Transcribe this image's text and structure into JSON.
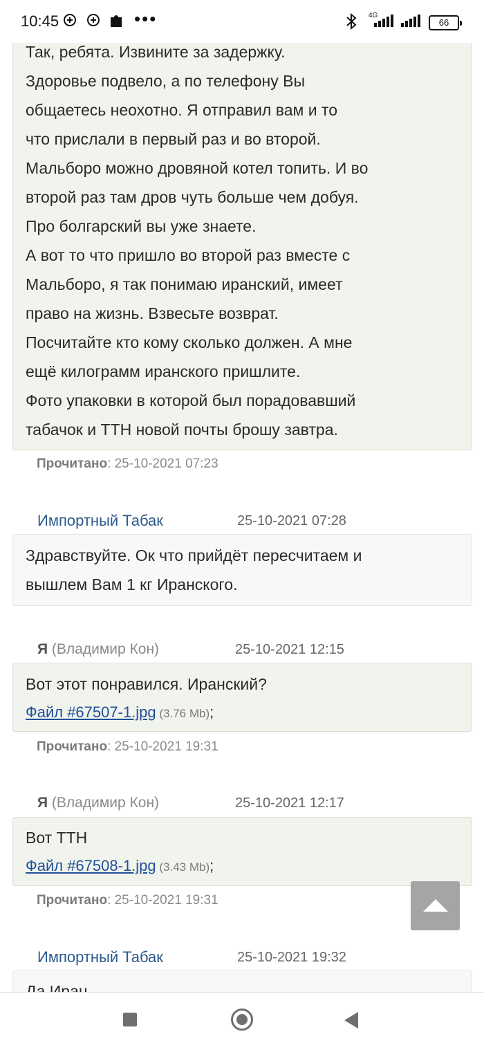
{
  "status_bar": {
    "time": "10:45",
    "network": "4G",
    "battery": "66",
    "icons": [
      "location-plus-icon",
      "location-plus-icon",
      "puzzle-icon",
      "more-dots-icon",
      "bluetooth-icon",
      "signal-icon",
      "signal-icon",
      "battery-icon"
    ]
  },
  "messages": [
    {
      "lines": [
        "Так, ребята. Извините за задержку.",
        "Здоровье подвело, а по телефону Вы",
        "общаетесь неохотно. Я отправил вам и то",
        "что прислали в первый раз и во второй.",
        "Мальборо можно дровяной котел топить. И во",
        "второй раз там дров чуть больше чем добуя.",
        "Про болгарский вы уже знаете.",
        "А вот то что пришло во второй раз вместе с",
        "Мальборо, я так понимаю иранский, имеет",
        "право на жизнь. Взвесьте возврат.",
        "Посчитайте кто кому сколько должен. А мне",
        "ещё килограмм иранского пришлите.",
        "Фото упаковки в которой был порадовавший",
        "табачок и ТТН новой почты брошу завтра."
      ],
      "read_label": "Прочитано",
      "read_time": ": 25-10-2021 07:23"
    },
    {
      "sender": "Импортный Табак",
      "time": "25-10-2021 07:28",
      "lines": [
        "Здравствуйте. Ок что прийдёт пересчитаем и",
        "вышлем Вам 1 кг Иранского."
      ]
    },
    {
      "sender_me": "Я",
      "sender_name": " (Владимир Кон)",
      "time": "25-10-2021 12:15",
      "text": "Вот этот понравился. Иранский?",
      "file_link": "Файл #67507-1.jpg",
      "file_size": " (3.76 Mb)",
      "file_sep": ";",
      "read_label": "Прочитано",
      "read_time": ": 25-10-2021 19:31"
    },
    {
      "sender_me": "Я",
      "sender_name": " (Владимир Кон)",
      "time": "25-10-2021 12:17",
      "text": "Вот ТТН",
      "file_link": "Файл #67508-1.jpg",
      "file_size": " (3.43 Mb)",
      "file_sep": ";",
      "read_label": "Прочитано",
      "read_time": ": 25-10-2021 19:31"
    },
    {
      "sender": "Импортный Табак",
      "time": "25-10-2021 19:32",
      "text": "Да Иран"
    }
  ],
  "nav": {
    "recents": "square-icon",
    "home": "circle-icon",
    "back": "triangle-icon"
  }
}
